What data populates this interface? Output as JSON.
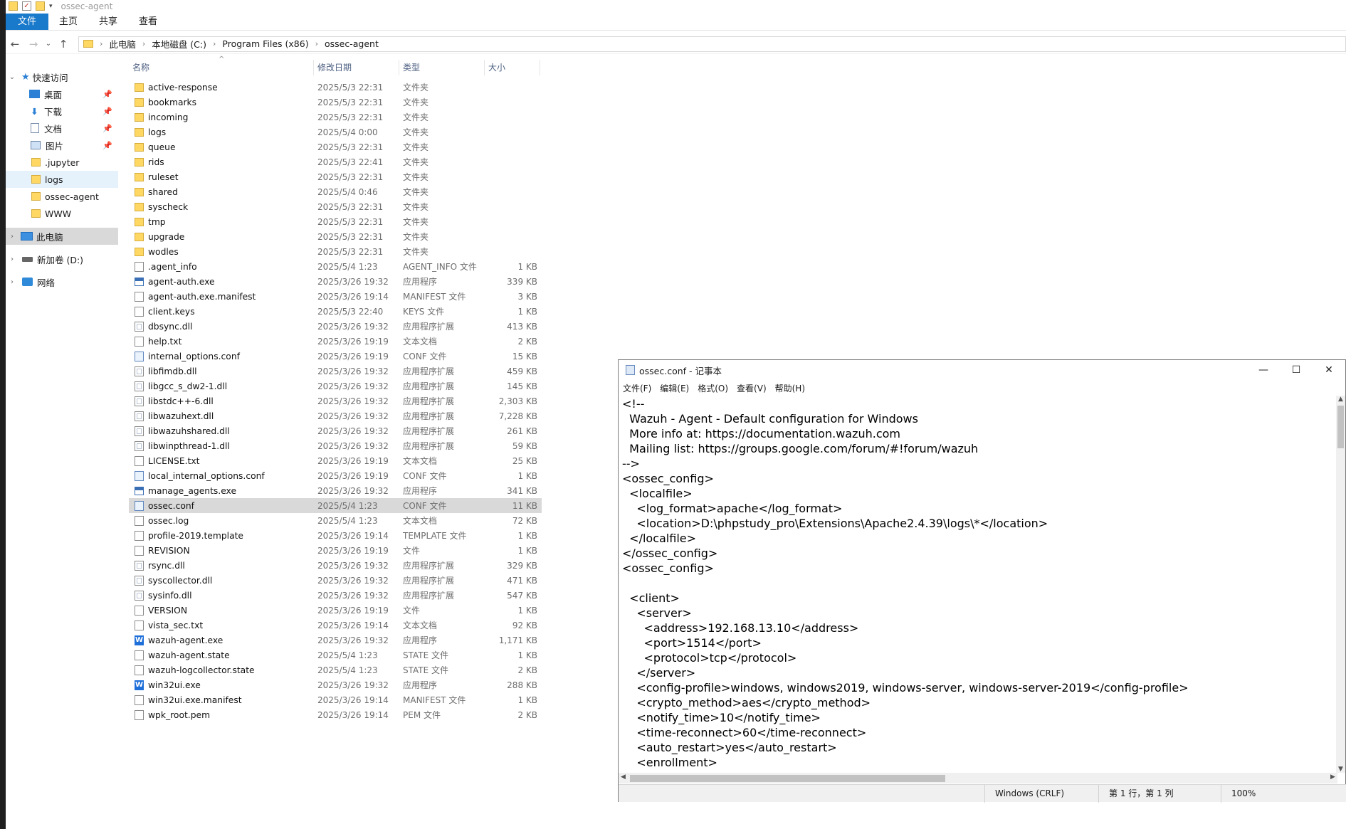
{
  "explorer": {
    "title": "ossec-agent",
    "ribbon_tabs": [
      "文件",
      "主页",
      "共享",
      "查看"
    ],
    "breadcrumb": [
      "此电脑",
      "本地磁盘 (C:)",
      "Program Files (x86)",
      "ossec-agent"
    ],
    "nav": {
      "quick_access": "快速访问",
      "quick_items": [
        "桌面",
        "下载",
        "文档",
        "图片"
      ],
      "folders": [
        ".jupyter",
        "logs",
        "ossec-agent",
        "WWW"
      ],
      "this_pc": "此电脑",
      "drive_d": "新加卷 (D:)",
      "network": "网络"
    },
    "columns": {
      "name": "名称",
      "date": "修改日期",
      "type": "类型",
      "size": "大小"
    },
    "files": [
      {
        "name": "active-response",
        "date": "2025/5/3 22:31",
        "type": "文件夹",
        "size": "",
        "icon": "folder-icon"
      },
      {
        "name": "bookmarks",
        "date": "2025/5/3 22:31",
        "type": "文件夹",
        "size": "",
        "icon": "folder-icon"
      },
      {
        "name": "incoming",
        "date": "2025/5/3 22:31",
        "type": "文件夹",
        "size": "",
        "icon": "folder-icon"
      },
      {
        "name": "logs",
        "date": "2025/5/4 0:00",
        "type": "文件夹",
        "size": "",
        "icon": "folder-icon"
      },
      {
        "name": "queue",
        "date": "2025/5/3 22:31",
        "type": "文件夹",
        "size": "",
        "icon": "folder-icon"
      },
      {
        "name": "rids",
        "date": "2025/5/3 22:41",
        "type": "文件夹",
        "size": "",
        "icon": "folder-icon"
      },
      {
        "name": "ruleset",
        "date": "2025/5/3 22:31",
        "type": "文件夹",
        "size": "",
        "icon": "folder-icon"
      },
      {
        "name": "shared",
        "date": "2025/5/4 0:46",
        "type": "文件夹",
        "size": "",
        "icon": "folder-icon"
      },
      {
        "name": "syscheck",
        "date": "2025/5/3 22:31",
        "type": "文件夹",
        "size": "",
        "icon": "folder-icon"
      },
      {
        "name": "tmp",
        "date": "2025/5/3 22:31",
        "type": "文件夹",
        "size": "",
        "icon": "folder-icon"
      },
      {
        "name": "upgrade",
        "date": "2025/5/3 22:31",
        "type": "文件夹",
        "size": "",
        "icon": "folder-icon"
      },
      {
        "name": "wodles",
        "date": "2025/5/3 22:31",
        "type": "文件夹",
        "size": "",
        "icon": "folder-icon"
      },
      {
        "name": ".agent_info",
        "date": "2025/5/4 1:23",
        "type": "AGENT_INFO 文件",
        "size": "1 KB",
        "icon": "file-icon"
      },
      {
        "name": "agent-auth.exe",
        "date": "2025/3/26 19:32",
        "type": "应用程序",
        "size": "339 KB",
        "icon": "exe-icon"
      },
      {
        "name": "agent-auth.exe.manifest",
        "date": "2025/3/26 19:14",
        "type": "MANIFEST 文件",
        "size": "3 KB",
        "icon": "file-icon"
      },
      {
        "name": "client.keys",
        "date": "2025/5/3 22:40",
        "type": "KEYS 文件",
        "size": "1 KB",
        "icon": "file-icon"
      },
      {
        "name": "dbsync.dll",
        "date": "2025/3/26 19:32",
        "type": "应用程序扩展",
        "size": "413 KB",
        "icon": "dll-icon"
      },
      {
        "name": "help.txt",
        "date": "2025/3/26 19:19",
        "type": "文本文档",
        "size": "2 KB",
        "icon": "file-icon"
      },
      {
        "name": "internal_options.conf",
        "date": "2025/3/26 19:19",
        "type": "CONF 文件",
        "size": "15 KB",
        "icon": "conf-icon"
      },
      {
        "name": "libfimdb.dll",
        "date": "2025/3/26 19:32",
        "type": "应用程序扩展",
        "size": "459 KB",
        "icon": "dll-icon"
      },
      {
        "name": "libgcc_s_dw2-1.dll",
        "date": "2025/3/26 19:32",
        "type": "应用程序扩展",
        "size": "145 KB",
        "icon": "dll-icon"
      },
      {
        "name": "libstdc++-6.dll",
        "date": "2025/3/26 19:32",
        "type": "应用程序扩展",
        "size": "2,303 KB",
        "icon": "dll-icon"
      },
      {
        "name": "libwazuhext.dll",
        "date": "2025/3/26 19:32",
        "type": "应用程序扩展",
        "size": "7,228 KB",
        "icon": "dll-icon"
      },
      {
        "name": "libwazuhshared.dll",
        "date": "2025/3/26 19:32",
        "type": "应用程序扩展",
        "size": "261 KB",
        "icon": "dll-icon"
      },
      {
        "name": "libwinpthread-1.dll",
        "date": "2025/3/26 19:32",
        "type": "应用程序扩展",
        "size": "59 KB",
        "icon": "dll-icon"
      },
      {
        "name": "LICENSE.txt",
        "date": "2025/3/26 19:19",
        "type": "文本文档",
        "size": "25 KB",
        "icon": "file-icon"
      },
      {
        "name": "local_internal_options.conf",
        "date": "2025/3/26 19:19",
        "type": "CONF 文件",
        "size": "1 KB",
        "icon": "conf-icon"
      },
      {
        "name": "manage_agents.exe",
        "date": "2025/3/26 19:32",
        "type": "应用程序",
        "size": "341 KB",
        "icon": "exe-icon"
      },
      {
        "name": "ossec.conf",
        "date": "2025/5/4 1:23",
        "type": "CONF 文件",
        "size": "11 KB",
        "icon": "conf-icon",
        "selected": true
      },
      {
        "name": "ossec.log",
        "date": "2025/5/4 1:23",
        "type": "文本文档",
        "size": "72 KB",
        "icon": "file-icon"
      },
      {
        "name": "profile-2019.template",
        "date": "2025/3/26 19:14",
        "type": "TEMPLATE 文件",
        "size": "1 KB",
        "icon": "file-icon"
      },
      {
        "name": "REVISION",
        "date": "2025/3/26 19:19",
        "type": "文件",
        "size": "1 KB",
        "icon": "file-icon"
      },
      {
        "name": "rsync.dll",
        "date": "2025/3/26 19:32",
        "type": "应用程序扩展",
        "size": "329 KB",
        "icon": "dll-icon"
      },
      {
        "name": "syscollector.dll",
        "date": "2025/3/26 19:32",
        "type": "应用程序扩展",
        "size": "471 KB",
        "icon": "dll-icon"
      },
      {
        "name": "sysinfo.dll",
        "date": "2025/3/26 19:32",
        "type": "应用程序扩展",
        "size": "547 KB",
        "icon": "dll-icon"
      },
      {
        "name": "VERSION",
        "date": "2025/3/26 19:19",
        "type": "文件",
        "size": "1 KB",
        "icon": "file-icon"
      },
      {
        "name": "vista_sec.txt",
        "date": "2025/3/26 19:14",
        "type": "文本文档",
        "size": "92 KB",
        "icon": "file-icon"
      },
      {
        "name": "wazuh-agent.exe",
        "date": "2025/3/26 19:32",
        "type": "应用程序",
        "size": "1,171 KB",
        "icon": "wazuh-w-icon"
      },
      {
        "name": "wazuh-agent.state",
        "date": "2025/5/4 1:23",
        "type": "STATE 文件",
        "size": "1 KB",
        "icon": "file-icon"
      },
      {
        "name": "wazuh-logcollector.state",
        "date": "2025/5/4 1:23",
        "type": "STATE 文件",
        "size": "2 KB",
        "icon": "file-icon"
      },
      {
        "name": "win32ui.exe",
        "date": "2025/3/26 19:32",
        "type": "应用程序",
        "size": "288 KB",
        "icon": "wazuh-w-icon"
      },
      {
        "name": "win32ui.exe.manifest",
        "date": "2025/3/26 19:14",
        "type": "MANIFEST 文件",
        "size": "1 KB",
        "icon": "file-icon"
      },
      {
        "name": "wpk_root.pem",
        "date": "2025/3/26 19:14",
        "type": "PEM 文件",
        "size": "2 KB",
        "icon": "file-icon"
      }
    ]
  },
  "notepad": {
    "title": "ossec.conf - 记事本",
    "menu": [
      "文件(F)",
      "编辑(E)",
      "格式(O)",
      "查看(V)",
      "帮助(H)"
    ],
    "lines": [
      "<!--",
      "  Wazuh - Agent - Default configuration for Windows",
      "  More info at: https://documentation.wazuh.com",
      "  Mailing list: https://groups.google.com/forum/#!forum/wazuh",
      "-->",
      "<ossec_config>",
      "  <localfile>",
      "    <log_format>apache</log_format>",
      "    <location>D:\\phpstudy_pro\\Extensions\\Apache2.4.39\\logs\\*</location>",
      "  </localfile>",
      "</ossec_config>",
      "<ossec_config>",
      "",
      "  <client>",
      "    <server>",
      "      <address>192.168.13.10</address>",
      "      <port>1514</port>",
      "      <protocol>tcp</protocol>",
      "    </server>",
      "    <config-profile>windows, windows2019, windows-server, windows-server-2019</config-profile>",
      "    <crypto_method>aes</crypto_method>",
      "    <notify_time>10</notify_time>",
      "    <time-reconnect>60</time-reconnect>",
      "    <auto_restart>yes</auto_restart>",
      "    <enrollment>"
    ],
    "status": {
      "encoding": "Windows (CRLF)",
      "position": "第 1 行，第 1 列",
      "zoom": "100%"
    }
  }
}
